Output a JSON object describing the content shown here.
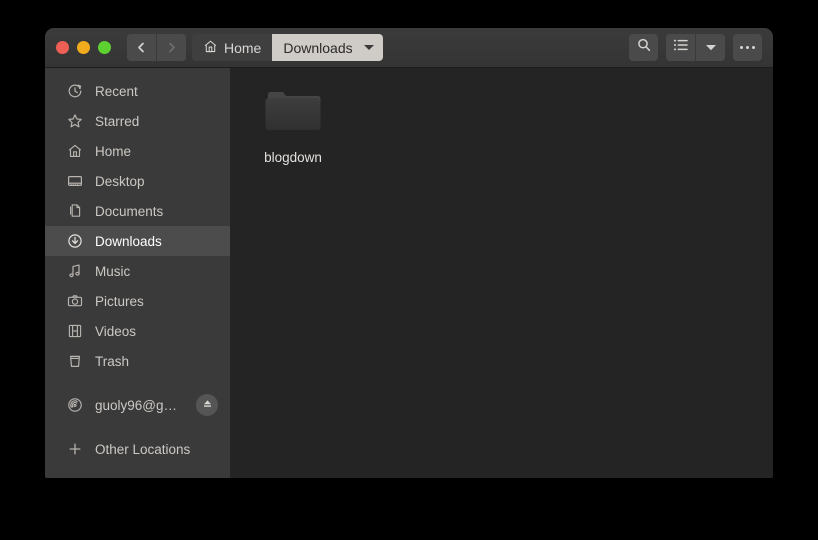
{
  "window": {
    "traffic_lights": [
      {
        "name": "close",
        "color": "#ee5f56"
      },
      {
        "name": "minimize",
        "color": "#f0ac1c"
      },
      {
        "name": "maximize",
        "color": "#5dd130"
      }
    ]
  },
  "toolbar": {
    "back_icon": "chevron-left-icon",
    "forward_icon": "chevron-right-icon",
    "breadcrumb": [
      {
        "label": "Home",
        "icon": "home-icon",
        "active": false
      },
      {
        "label": "Downloads",
        "icon": "",
        "active": true
      }
    ],
    "search_icon": "search-icon",
    "list_view_icon": "list-view-icon",
    "view_caret_icon": "chevron-down-icon",
    "menu_icon": "ellipsis-icon"
  },
  "sidebar": {
    "items": [
      {
        "label": "Recent",
        "icon": "clock-icon",
        "selected": false
      },
      {
        "label": "Starred",
        "icon": "star-icon",
        "selected": false
      },
      {
        "label": "Home",
        "icon": "home-icon",
        "selected": false
      },
      {
        "label": "Desktop",
        "icon": "desktop-icon",
        "selected": false
      },
      {
        "label": "Documents",
        "icon": "documents-icon",
        "selected": false
      },
      {
        "label": "Downloads",
        "icon": "download-icon",
        "selected": true
      },
      {
        "label": "Music",
        "icon": "music-note-icon",
        "selected": false
      },
      {
        "label": "Pictures",
        "icon": "camera-icon",
        "selected": false
      },
      {
        "label": "Videos",
        "icon": "film-icon",
        "selected": false
      },
      {
        "label": "Trash",
        "icon": "trash-icon",
        "selected": false
      }
    ],
    "device": {
      "label": "guoly96@g…",
      "icon": "network-share-icon",
      "eject_icon": "eject-icon"
    },
    "other_locations": {
      "label": "Other Locations",
      "icon": "plus-icon"
    }
  },
  "main": {
    "files": [
      {
        "name": "blogdown",
        "type": "folder",
        "icon": "folder-icon"
      }
    ]
  },
  "colors": {
    "desktop_background": "#000000",
    "window_background": "#242424",
    "headerbar": "#383838",
    "sidebar": "#3a3a3a",
    "sidebar_selected": "#4c4c4c",
    "text": "#ccc8c4",
    "active_crumb_background": "#cfcbc6"
  }
}
